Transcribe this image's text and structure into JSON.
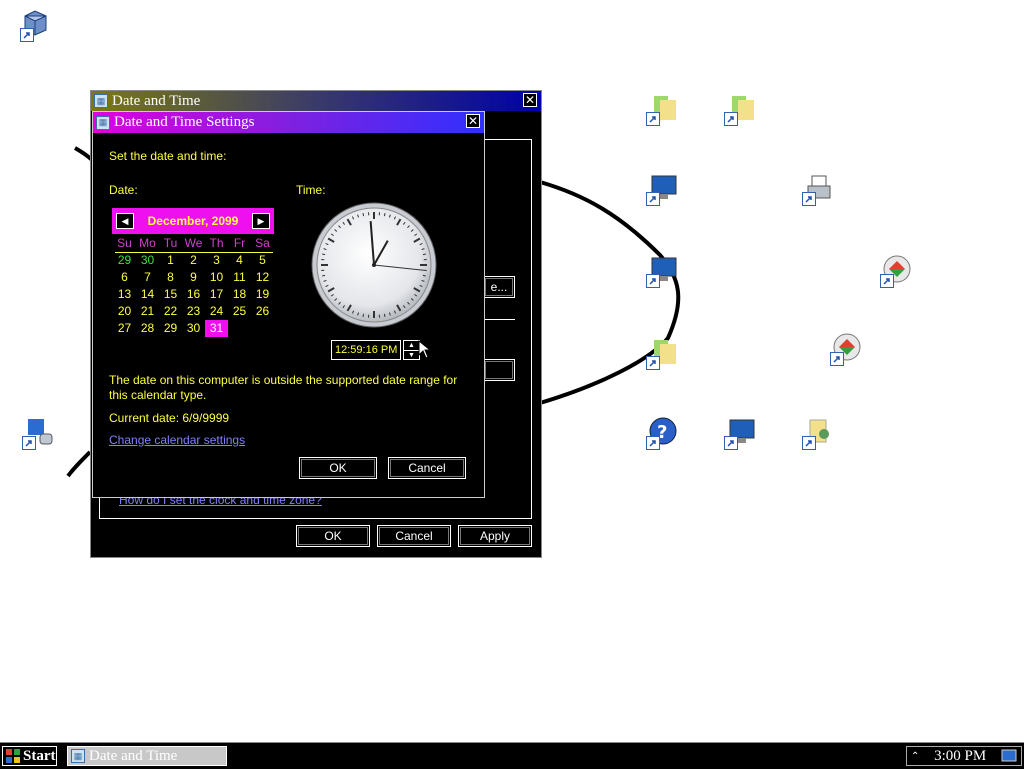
{
  "outer_window": {
    "title": "Date and Time",
    "partial_button_label": "e...",
    "help_link": "How do I set the clock and time zone?",
    "ok_label": "OK",
    "cancel_label": "Cancel",
    "apply_label": "Apply"
  },
  "dialog": {
    "title": "Date and Time Settings",
    "instruction": "Set the date and time:",
    "date_label": "Date:",
    "time_label": "Time:",
    "calendar": {
      "month_year": "December, 2099",
      "days_of_week": [
        "Su",
        "Mo",
        "Tu",
        "We",
        "Th",
        "Fr",
        "Sa"
      ],
      "weeks": [
        [
          "29",
          "30",
          "1",
          "2",
          "3",
          "4",
          "5"
        ],
        [
          "6",
          "7",
          "8",
          "9",
          "10",
          "11",
          "12"
        ],
        [
          "13",
          "14",
          "15",
          "16",
          "17",
          "18",
          "19"
        ],
        [
          "20",
          "21",
          "22",
          "23",
          "24",
          "25",
          "26"
        ],
        [
          "27",
          "28",
          "29",
          "30",
          "31",
          "",
          ""
        ]
      ],
      "selected_day": "31"
    },
    "clock": {
      "hour": 12,
      "minute": 59,
      "second": 16
    },
    "time_value": "12:59:16 PM",
    "warning": "The date on this computer is outside the supported date range for this calendar type.",
    "current_date": "Current date: 6/9/9999",
    "calendar_link": "Change calendar settings",
    "ok_label": "OK",
    "cancel_label": "Cancel"
  },
  "taskbar": {
    "start_label": "Start",
    "task_label": "Date and Time",
    "clock": "3:00 PM"
  },
  "colors": {
    "accent_magenta": "#ee10ee",
    "text_yellow": "#ffff40",
    "link_blue": "#8080ff"
  }
}
